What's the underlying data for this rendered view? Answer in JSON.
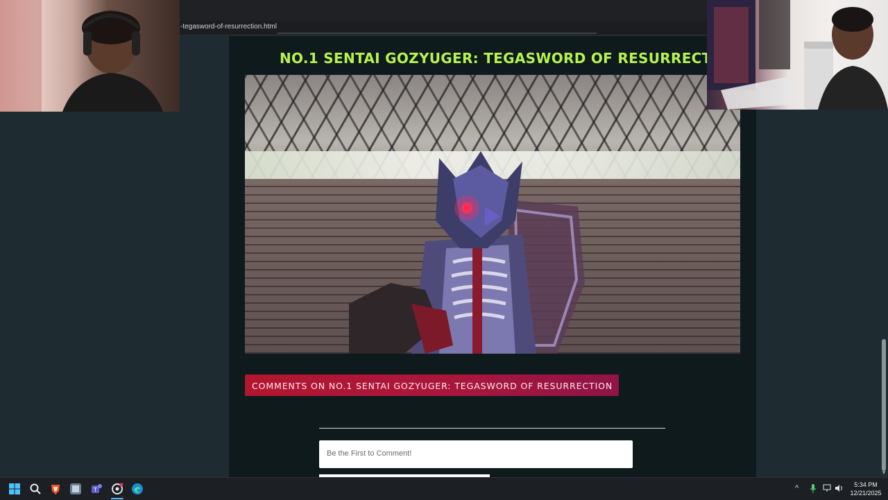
{
  "browser": {
    "url_fragment": "-tegasword-of-resurrection.html"
  },
  "page": {
    "title": "NO.1 SENTAI GOZYUGER: TEGASWORD OF RESURRECTION",
    "comments_heading": "COMMENTS ON NO.1 SENTAI GOZYUGER: TEGASWORD OF RESURRECTION",
    "comment_placeholder": "Be the First to Comment!"
  },
  "colors": {
    "title": "#b7f34e",
    "banner": "#b3172f",
    "content_bg": "#0f1a1d",
    "page_bg": "#1e2c31"
  },
  "taskbar": {
    "icons": [
      "windows-start-icon",
      "search-icon",
      "brave-browser-icon",
      "app-icon",
      "teams-icon",
      "chatgpt-icon",
      "edge-icon"
    ],
    "time": "5:34 PM",
    "date": "12/21/2025"
  }
}
